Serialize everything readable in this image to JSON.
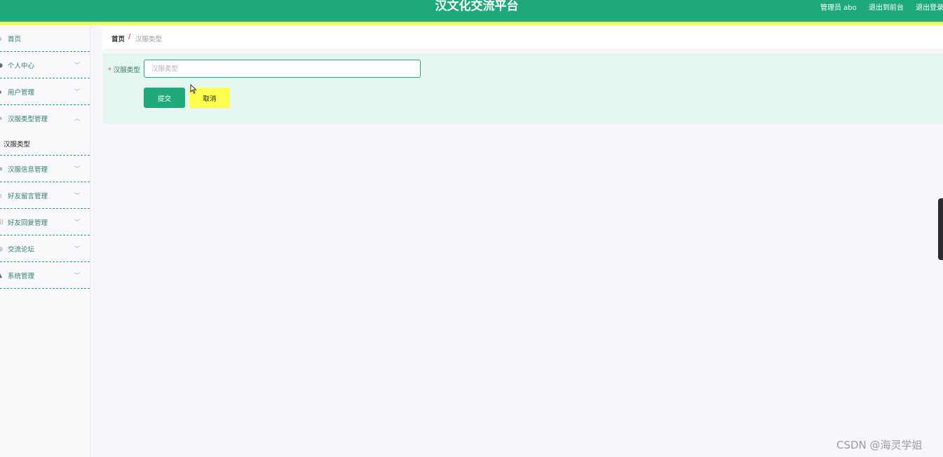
{
  "header": {
    "title": "汉文化交流平台",
    "user": "管理员 abo",
    "to_front": "退出到前台",
    "logout": "退出登录",
    "bg_color": "#1fa97b",
    "stripe_color": "#ecff57"
  },
  "sidebar": {
    "items": [
      {
        "label": "首页",
        "icon": "home-icon"
      },
      {
        "label": "个人中心",
        "icon": "user-icon"
      },
      {
        "label": "用户管理",
        "icon": "grid-icon"
      },
      {
        "label": "汉服类型管理",
        "icon": "edit-icon",
        "expanded": true
      },
      {
        "label": "汉服信息管理",
        "icon": "list-icon"
      },
      {
        "label": "好友留言管理",
        "icon": "message-icon"
      },
      {
        "label": "好友回复管理",
        "icon": "checkbox-icon"
      },
      {
        "label": "交流论坛",
        "icon": "discover-icon"
      },
      {
        "label": "系统管理",
        "icon": "settings-icon"
      }
    ],
    "submenu": {
      "label": "汉服类型"
    }
  },
  "breadcrumb": {
    "home": "首页",
    "separator": "/",
    "current": "汉服类型"
  },
  "form": {
    "label": "汉服类型",
    "required_mark": "*",
    "placeholder": "汉服类型",
    "value": "",
    "submit": "提交",
    "cancel": "取消"
  },
  "watermark": "CSDN @海灵学姐"
}
